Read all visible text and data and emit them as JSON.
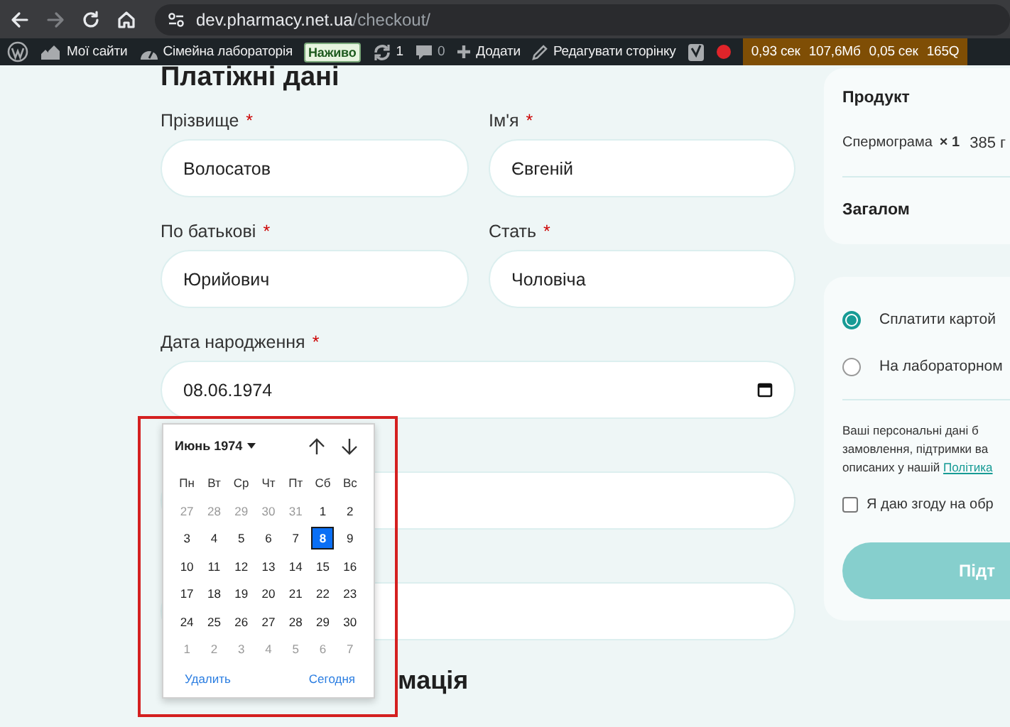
{
  "browser": {
    "url_host": "dev.pharmacy.net.ua",
    "url_path": "/checkout/"
  },
  "admin_bar": {
    "my_sites": "Мої сайти",
    "site": "Сімейна лабораторія",
    "live_badge": "Наживо",
    "updates": "1",
    "comments": "0",
    "new": "Додати",
    "edit": "Редагувати сторінку",
    "stats": [
      "0,93 сек",
      "107,6Мб",
      "0,05 сек",
      "165Q"
    ]
  },
  "billing": {
    "title": "Платіжні дані",
    "fields": [
      {
        "label": "Прізвище",
        "mark": "*",
        "value": "Волосатов",
        "kind": "text"
      },
      {
        "label": "Ім'я",
        "mark": "*",
        "value": "Євгеній",
        "kind": "text"
      },
      {
        "label": "По батькові",
        "mark": "*",
        "value": "Юрийович",
        "kind": "text"
      },
      {
        "label": "Стать",
        "mark": "*",
        "value": "Чоловіча",
        "kind": "text"
      },
      {
        "label": "Дата народження",
        "mark": "*",
        "value": "08.06.1974",
        "kind": "date"
      }
    ],
    "covered_fields": [
      {
        "kind": "text"
      },
      {
        "kind": "text"
      }
    ]
  },
  "section2": {
    "title": "мація"
  },
  "calendar": {
    "month": "Июнь 1974",
    "weekdays": [
      "Пн",
      "Вт",
      "Ср",
      "Чт",
      "Пт",
      "Сб",
      "Вс"
    ],
    "weeks": [
      [
        {
          "day": "27",
          "outside": true,
          "selected": false
        },
        {
          "day": "28",
          "outside": true,
          "selected": false
        },
        {
          "day": "29",
          "outside": true,
          "selected": false
        },
        {
          "day": "30",
          "outside": true,
          "selected": false
        },
        {
          "day": "31",
          "outside": true,
          "selected": false
        },
        {
          "day": "1",
          "outside": false,
          "selected": false
        },
        {
          "day": "2",
          "outside": false,
          "selected": false
        }
      ],
      [
        {
          "day": "3",
          "outside": false,
          "selected": false
        },
        {
          "day": "4",
          "outside": false,
          "selected": false
        },
        {
          "day": "5",
          "outside": false,
          "selected": false
        },
        {
          "day": "6",
          "outside": false,
          "selected": false
        },
        {
          "day": "7",
          "outside": false,
          "selected": false
        },
        {
          "day": "8",
          "outside": false,
          "selected": true
        },
        {
          "day": "9",
          "outside": false,
          "selected": false
        }
      ],
      [
        {
          "day": "10",
          "outside": false,
          "selected": false
        },
        {
          "day": "11",
          "outside": false,
          "selected": false
        },
        {
          "day": "12",
          "outside": false,
          "selected": false
        },
        {
          "day": "13",
          "outside": false,
          "selected": false
        },
        {
          "day": "14",
          "outside": false,
          "selected": false
        },
        {
          "day": "15",
          "outside": false,
          "selected": false
        },
        {
          "day": "16",
          "outside": false,
          "selected": false
        }
      ],
      [
        {
          "day": "17",
          "outside": false,
          "selected": false
        },
        {
          "day": "18",
          "outside": false,
          "selected": false
        },
        {
          "day": "19",
          "outside": false,
          "selected": false
        },
        {
          "day": "20",
          "outside": false,
          "selected": false
        },
        {
          "day": "21",
          "outside": false,
          "selected": false
        },
        {
          "day": "22",
          "outside": false,
          "selected": false
        },
        {
          "day": "23",
          "outside": false,
          "selected": false
        }
      ],
      [
        {
          "day": "24",
          "outside": false,
          "selected": false
        },
        {
          "day": "25",
          "outside": false,
          "selected": false
        },
        {
          "day": "26",
          "outside": false,
          "selected": false
        },
        {
          "day": "27",
          "outside": false,
          "selected": false
        },
        {
          "day": "28",
          "outside": false,
          "selected": false
        },
        {
          "day": "29",
          "outside": false,
          "selected": false
        },
        {
          "day": "30",
          "outside": false,
          "selected": false
        }
      ],
      [
        {
          "day": "1",
          "outside": true,
          "selected": false
        },
        {
          "day": "2",
          "outside": true,
          "selected": false
        },
        {
          "day": "3",
          "outside": true,
          "selected": false
        },
        {
          "day": "4",
          "outside": true,
          "selected": false
        },
        {
          "day": "5",
          "outside": true,
          "selected": false
        },
        {
          "day": "6",
          "outside": true,
          "selected": false
        },
        {
          "day": "7",
          "outside": true,
          "selected": false
        }
      ]
    ],
    "clear": "Удалить",
    "today": "Сегодня"
  },
  "order": {
    "header": "Продукт",
    "item": "Спермограма",
    "qty": "× 1",
    "price": "385 г",
    "total": "Загалом"
  },
  "payment": {
    "methods": [
      {
        "label": "Сплатити картой",
        "selected": true
      },
      {
        "label": "На лабораторном",
        "selected": false
      }
    ],
    "privacy_lines": [
      "Ваші персональні дані б",
      "замовлення, підтримки ва",
      "описаних у нашій"
    ],
    "privacy_link": "Політика",
    "consent": {
      "label": "Я даю згоду на обр",
      "checked": false
    },
    "button": "Підт"
  }
}
